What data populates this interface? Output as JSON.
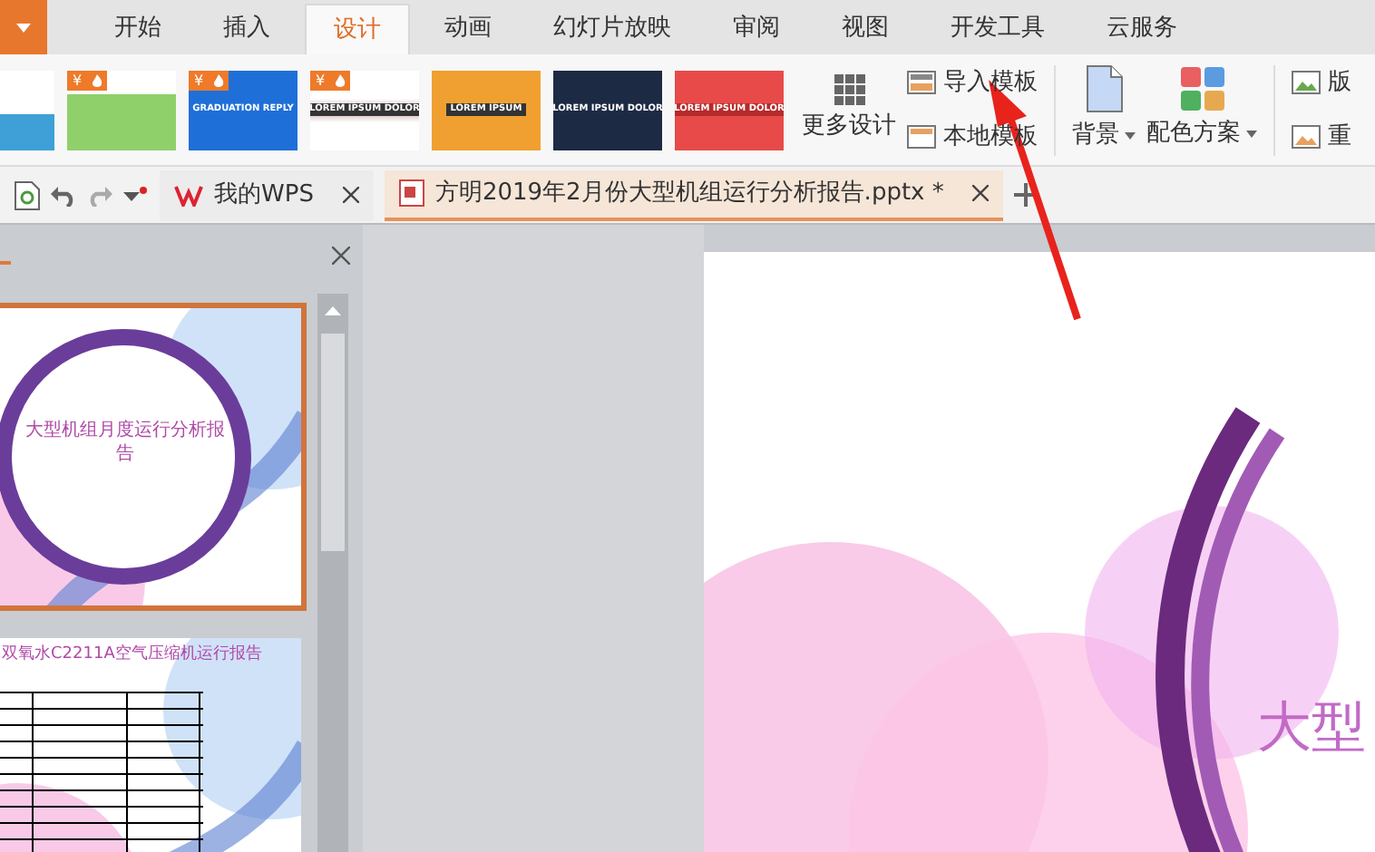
{
  "menu_tabs": [
    {
      "label": "开始",
      "selected": false
    },
    {
      "label": "插入",
      "selected": false
    },
    {
      "label": "设计",
      "selected": true
    },
    {
      "label": "动画",
      "selected": false
    },
    {
      "label": "幻灯片放映",
      "selected": false
    },
    {
      "label": "审阅",
      "selected": false
    },
    {
      "label": "视图",
      "selected": false
    },
    {
      "label": "开发工具",
      "selected": false
    },
    {
      "label": "云服务",
      "selected": false
    }
  ],
  "themes": [
    {
      "kind": "mountains"
    },
    {
      "kind": "city",
      "badge": "¥"
    },
    {
      "kind": "cubes",
      "badge": "¥",
      "caption": "GRADUATION REPLY"
    },
    {
      "kind": "banner",
      "badge": "¥",
      "caption": "LOREM IPSUM DOLOR"
    },
    {
      "kind": "phone",
      "caption": "LOREM IPSUM"
    },
    {
      "kind": "skyline",
      "caption": "LOREM IPSUM DOLOR"
    },
    {
      "kind": "red",
      "caption": "LOREM IPSUM DOLOR"
    }
  ],
  "more_designs": "更多设计",
  "template_buttons": [
    "导入模板",
    "本地模板"
  ],
  "background_button": "背景",
  "color_scheme_button": "配色方案",
  "layout_buttons": [
    "版",
    "重"
  ],
  "doc_tabs": [
    {
      "label": "我的WPS",
      "selected": false
    },
    {
      "label": "方明2019年2月份大型机组运行分析报告.pptx *",
      "selected": true
    }
  ],
  "slides": [
    {
      "title": "大型机组月度运行分析报告",
      "selected": true
    },
    {
      "title": "双氧水C2211A空气压缩机运行报告",
      "selected": false
    }
  ],
  "main_slide": {
    "title": "大型"
  }
}
